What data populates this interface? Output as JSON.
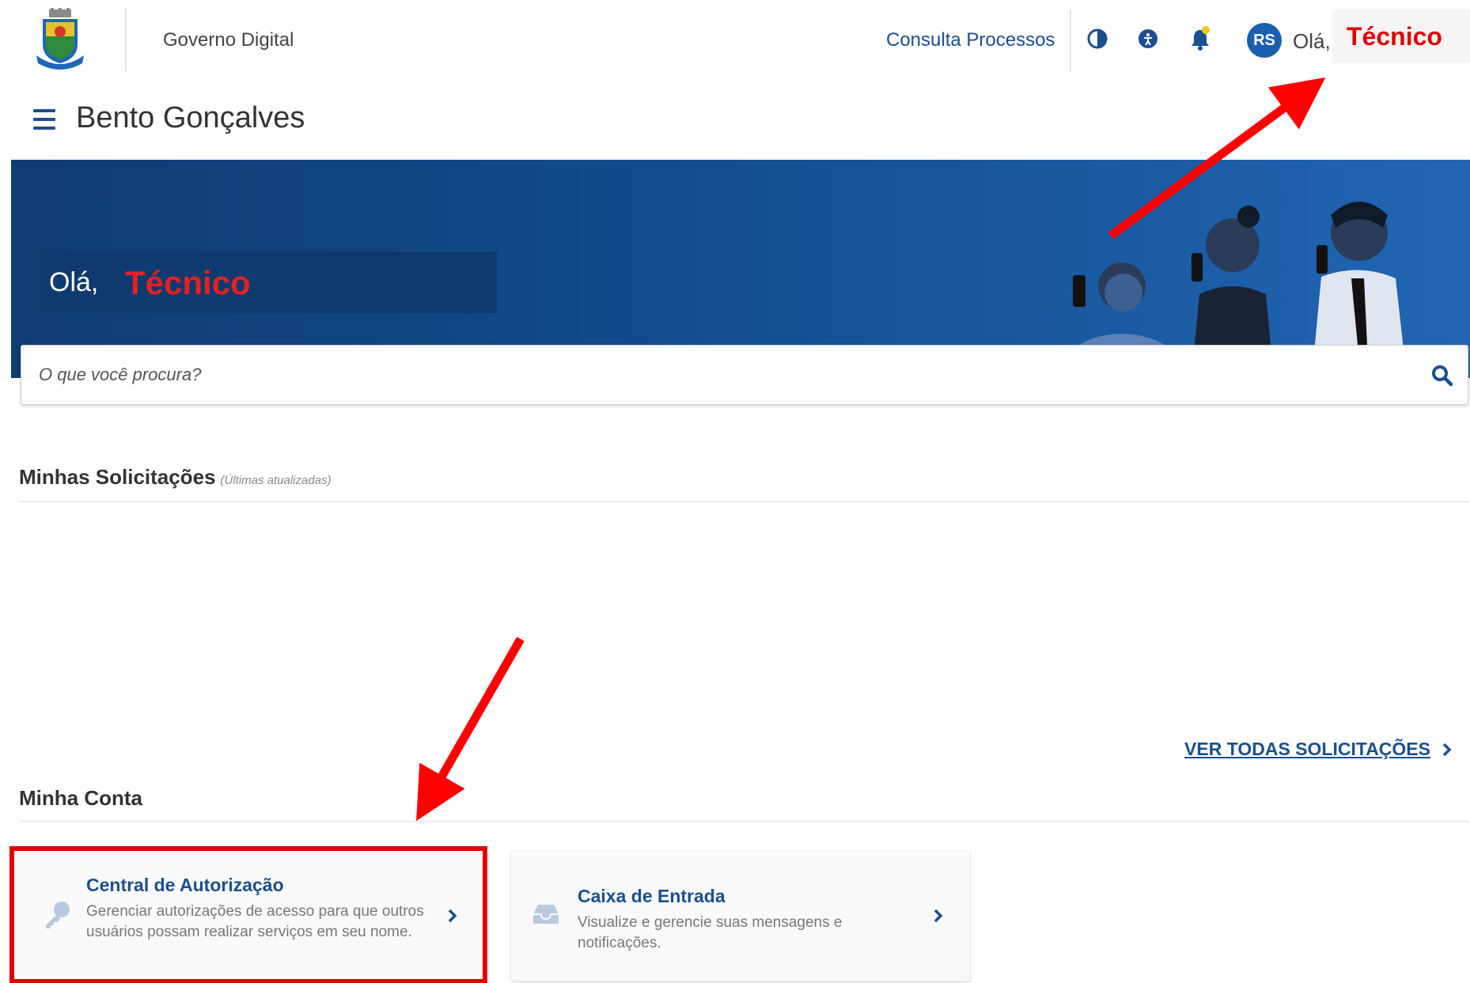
{
  "header": {
    "brand": "Governo Digital",
    "consulta_link": "Consulta Processos",
    "icons": [
      "contrast-icon",
      "accessibility-icon",
      "notification-bell-icon"
    ],
    "avatar_initials": "RS",
    "greeting": "Olá,",
    "user_name": "Técnico"
  },
  "title_row": {
    "city": "Bento Gonçalves"
  },
  "banner": {
    "greeting": "Olá,",
    "user_name": "Técnico"
  },
  "search": {
    "placeholder": "O que você procura?"
  },
  "solicitacoes": {
    "title": "Minhas Solicitações",
    "subtitle": "(Últimas atualizadas)",
    "ver_todas": "VER TODAS SOLICITAÇÕES"
  },
  "conta": {
    "title": "Minha Conta",
    "cards": [
      {
        "title": "Central de Autorização",
        "description": "Gerenciar autorizações de acesso para que outros usuários possam realizar serviços em seu nome.",
        "icon": "key-icon"
      },
      {
        "title": "Caixa de Entrada",
        "description": "Visualize e gerencie suas mensagens e notificações.",
        "icon": "inbox-icon"
      }
    ]
  },
  "colors": {
    "primary": "#1b4f8f",
    "banner": "#124a8a",
    "highlight": "#e00000",
    "bell_dot": "#f5c518"
  }
}
